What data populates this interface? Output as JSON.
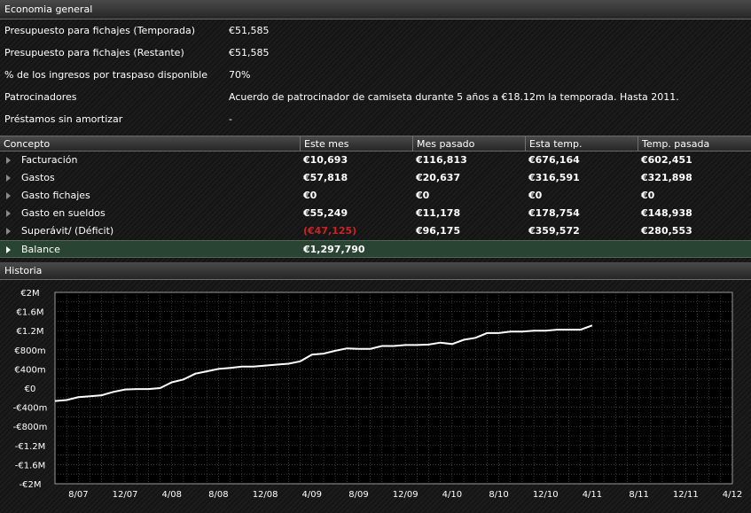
{
  "sections": {
    "general": "Economia general",
    "history": "Historia"
  },
  "info": [
    {
      "label": "Presupuesto para fichajes (Temporada)",
      "value": "€51,585"
    },
    {
      "label": "Presupuesto para fichajes (Restante)",
      "value": "€51,585"
    },
    {
      "label": "% de los ingresos por traspaso disponible",
      "value": "70%"
    },
    {
      "label": "Patrocinadores",
      "value": "Acuerdo de patrocinador de camiseta durante 5 años a €18.12m la temporada. Hasta 2011."
    },
    {
      "label": "Préstamos sin amortizar",
      "value": "-"
    }
  ],
  "table": {
    "headers": [
      "Concepto",
      "Este mes",
      "Mes pasado",
      "Esta temp.",
      "Temp. pasada"
    ],
    "rows": [
      {
        "name": "Facturación",
        "values": [
          "€10,693",
          "€116,813",
          "€676,164",
          "€602,451"
        ]
      },
      {
        "name": "Gastos",
        "values": [
          "€57,818",
          "€20,637",
          "€316,591",
          "€321,898"
        ]
      },
      {
        "name": "Gasto fichajes",
        "values": [
          "€0",
          "€0",
          "€0",
          "€0"
        ]
      },
      {
        "name": "Gasto en sueldos",
        "values": [
          "€55,249",
          "€11,178",
          "€178,754",
          "€148,938"
        ]
      },
      {
        "name": "Superávit/ (Déficit)",
        "values": [
          "(€47,125)",
          "€96,175",
          "€359,572",
          "€280,553"
        ]
      },
      {
        "name": "Balance",
        "values": [
          "€1,297,790",
          "",
          "",
          ""
        ]
      }
    ],
    "negative_color": "#cc2222",
    "balance_row_color": "#2a4433"
  },
  "chart_data": {
    "type": "line",
    "x_ticks": [
      "8/07",
      "12/07",
      "4/08",
      "8/08",
      "12/08",
      "4/09",
      "8/09",
      "12/09",
      "4/10",
      "8/10",
      "12/10",
      "4/11",
      "8/11",
      "12/11",
      "4/12"
    ],
    "y_ticks": [
      "€2M",
      "€1.6M",
      "€1.2M",
      "€800m",
      "€400m",
      "€0",
      "-€400m",
      "-€800m",
      "-€1.2M",
      "-€1.6M",
      "-€2M"
    ],
    "ylim": [
      -2000000,
      2000000
    ],
    "x_range_months": [
      "2007-06",
      "2012-04"
    ],
    "grid": true,
    "line_color": "#ffffff",
    "series": [
      {
        "x": [
          "2007-06",
          "2007-07",
          "2007-08",
          "2007-09",
          "2007-10",
          "2007-11",
          "2007-12",
          "2008-01",
          "2008-02",
          "2008-03",
          "2008-04",
          "2008-05",
          "2008-06",
          "2008-07",
          "2008-08",
          "2008-09",
          "2008-10",
          "2008-11",
          "2008-12",
          "2009-01",
          "2009-02",
          "2009-03",
          "2009-04",
          "2009-05",
          "2009-06",
          "2009-07",
          "2009-08",
          "2009-09",
          "2009-10",
          "2009-11",
          "2009-12",
          "2010-01",
          "2010-02",
          "2010-03",
          "2010-04",
          "2010-05",
          "2010-06",
          "2010-07",
          "2010-08",
          "2010-09",
          "2010-10",
          "2010-11",
          "2010-12",
          "2011-01",
          "2011-02",
          "2011-03",
          "2011-04"
        ],
        "y": [
          -270000,
          -250000,
          -190000,
          -170000,
          -150000,
          -80000,
          -30000,
          -20000,
          -20000,
          0,
          120000,
          180000,
          300000,
          350000,
          400000,
          420000,
          450000,
          450000,
          470000,
          490000,
          510000,
          560000,
          700000,
          720000,
          780000,
          830000,
          820000,
          820000,
          880000,
          880000,
          900000,
          900000,
          910000,
          950000,
          920000,
          1010000,
          1050000,
          1150000,
          1150000,
          1180000,
          1180000,
          1200000,
          1200000,
          1220000,
          1220000,
          1220000,
          1310000
        ]
      }
    ]
  }
}
